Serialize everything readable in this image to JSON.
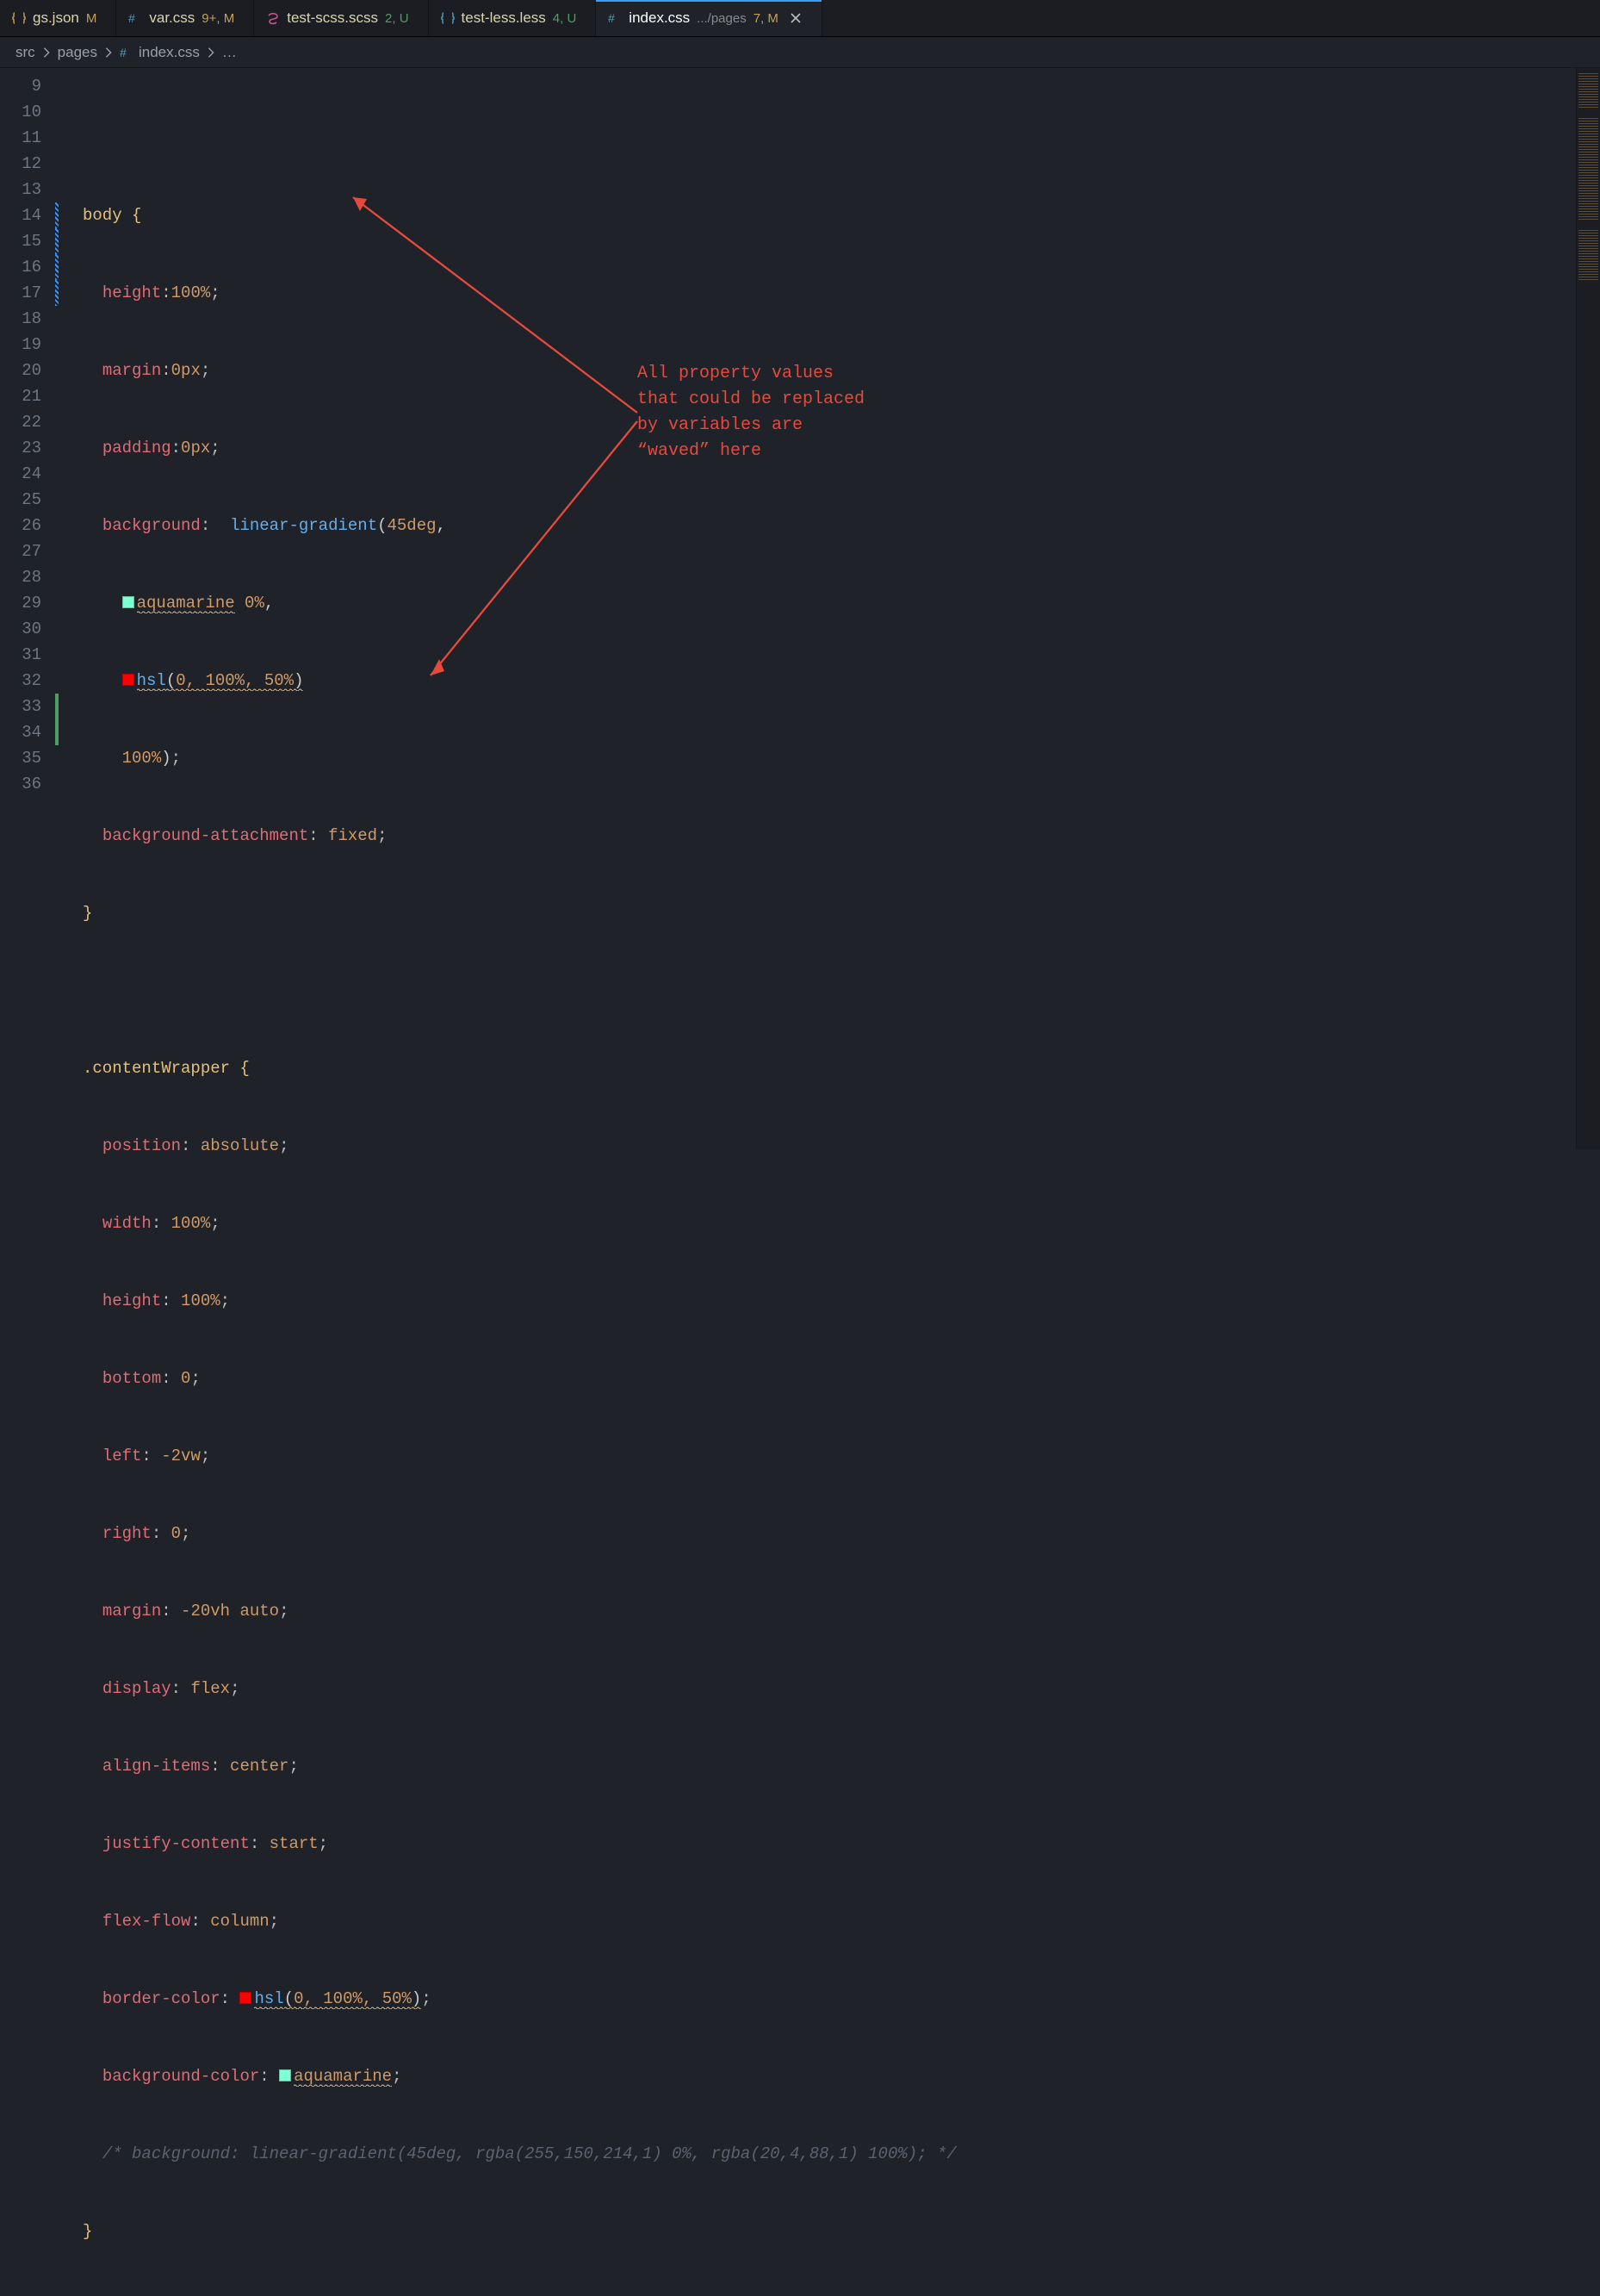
{
  "tabs": [
    {
      "icon": "json",
      "name": "gs.json",
      "suffix": "",
      "badge": "M",
      "badge_class": "n",
      "active": false
    },
    {
      "icon": "css",
      "name": "var.css",
      "suffix": "",
      "badge": "9+, M",
      "badge_class": "n",
      "active": false
    },
    {
      "icon": "scss",
      "name": "test-scss.scss",
      "suffix": "",
      "badge": "2, U",
      "badge_class": "u",
      "active": false
    },
    {
      "icon": "less",
      "name": "test-less.less",
      "suffix": "",
      "badge": "4, U",
      "badge_class": "u",
      "active": false
    },
    {
      "icon": "css",
      "name": "index.css",
      "suffix": ".../pages",
      "badge": "7, M",
      "badge_class": "n",
      "active": true
    }
  ],
  "breadcrumbs": [
    "src",
    "pages",
    "index.css",
    "…"
  ],
  "line_start": 9,
  "line_end": 36,
  "code": {
    "selector_body": "body",
    "brace_open": "{",
    "brace_close": "}",
    "selector_content": ".contentWrapper",
    "p_height": "height",
    "v_height": "100%",
    "semi": ";",
    "p_margin": "margin",
    "v_margin": "0px",
    "p_padding": "padding",
    "v_padding": "0px",
    "p_bg": "background",
    "f_lin": "linear-gradient",
    "arg_deg": "45deg",
    "comma": ",",
    "col_aqua": "aquamarine",
    "pct0": "0%",
    "f_hsl": "hsl",
    "hsl_args": "0, 100%, 50%",
    "paren_open": "(",
    "paren_close": ")",
    "pct100": "100%",
    "p_bga": "background-attachment",
    "v_fixed": "fixed",
    "p_pos": "position",
    "v_abs": "absolute",
    "p_width": "width",
    "v_100": "100%",
    "p_h2": "height",
    "v_h2": "100%",
    "p_bottom": "bottom",
    "v_0": "0",
    "p_left": "left",
    "v_left": "-2vw",
    "p_right": "right",
    "v_right": "0",
    "p_margin2": "margin",
    "v_margin2": "-20vh auto",
    "p_disp": "display",
    "v_flex": "flex",
    "p_align": "align-items",
    "v_center": "center",
    "p_just": "justify-content",
    "v_start": "start",
    "p_flow": "flex-flow",
    "v_col": "column",
    "p_bcol": "border-color",
    "p_bgc": "background-color",
    "comment": "/* background: linear-gradient(45deg, rgba(255,150,214,1) 0%, rgba(20,4,88,1) 100%); */"
  },
  "swatches": {
    "aquamarine": "#7FFFD4",
    "hsl_red": "#FF0000"
  },
  "annotation": {
    "text": "All property values that could be replaced by variables are “waved” here"
  }
}
